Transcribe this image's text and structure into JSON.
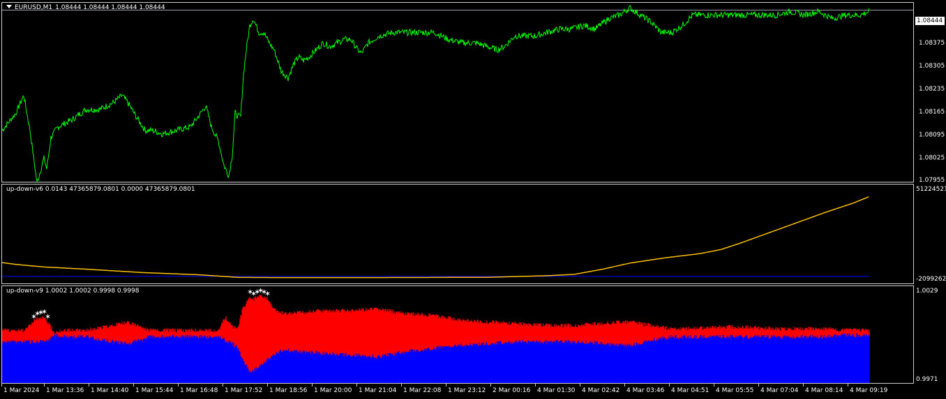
{
  "pane_main": {
    "symbol": "EURUSD,M1",
    "ohlc": "1.08444 1.08444 1.08444 1.08444",
    "current_price": "1.08444",
    "price_ticks": [
      "1.08375",
      "1.08305",
      "1.08235",
      "1.08165",
      "1.08095",
      "1.08025",
      "1.07955"
    ],
    "line_color": "#00ff00"
  },
  "pane_ind1": {
    "label": "up-down-v6 0.0143 47365879.0801 0.0000 47365879.0801",
    "top_tick": "51224521.",
    "bottom_tick": "-2099262.",
    "line_color": "#ffc000",
    "base_color": "#0000ff"
  },
  "pane_ind2": {
    "label": "up-down-v9 1.0002 1.0002 0.9998 0.9998",
    "top_tick": "1.0029",
    "bottom_tick": "0.9971",
    "up_color": "#ff0000",
    "down_color": "#0000ff",
    "marker_color": "#ffffff"
  },
  "time_axis": [
    "1 Mar 2024",
    "1 Mar 13:36",
    "1 Mar 14:40",
    "1 Mar 15:44",
    "1 Mar 16:48",
    "1 Mar 17:52",
    "1 Mar 18:56",
    "1 Mar 20:00",
    "1 Mar 21:04",
    "1 Mar 22:08",
    "1 Mar 23:12",
    "2 Mar 00:16",
    "4 Mar 01:30",
    "4 Mar 02:42",
    "4 Mar 03:46",
    "4 Mar 04:51",
    "4 Mar 05:55",
    "4 Mar 07:04",
    "4 Mar 08:14",
    "4 Mar 09:19"
  ],
  "chart_data": [
    {
      "type": "line",
      "ylim": [
        1.07955,
        1.08445
      ],
      "x": [
        0,
        20,
        31,
        40,
        50,
        60,
        64,
        70,
        80,
        100,
        120,
        140,
        160,
        172,
        180,
        195,
        205,
        215,
        230,
        250,
        270,
        285,
        292,
        300,
        310,
        318,
        325,
        330,
        334,
        338,
        342,
        346,
        350,
        355,
        360,
        368,
        375,
        383,
        390,
        400,
        410,
        418,
        425,
        432,
        440,
        450,
        460,
        470,
        480,
        490,
        500,
        510,
        515,
        525,
        540,
        560,
        575,
        590,
        605,
        620,
        630,
        640,
        660,
        680,
        695,
        710,
        720,
        735,
        750,
        765,
        780,
        800,
        815,
        835,
        850,
        870,
        885,
        900,
        915,
        930,
        945,
        960,
        975,
        990,
        1010,
        1030,
        1050,
        1070,
        1090,
        1110,
        1130,
        1150,
        1170,
        1190,
        1210,
        1230,
        1243
      ],
      "y": [
        1.081,
        1.0815,
        1.082,
        1.081,
        1.0795,
        1.0802,
        1.0799,
        1.0808,
        1.0811,
        1.0813,
        1.0816,
        1.0816,
        1.0818,
        1.082,
        1.0818,
        1.0813,
        1.081,
        1.081,
        1.0809,
        1.081,
        1.0811,
        1.0815,
        1.0817,
        1.0811,
        1.0807,
        1.08,
        1.0797,
        1.0803,
        1.0815,
        1.0814,
        1.0814,
        1.0826,
        1.0833,
        1.084,
        1.0842,
        1.0838,
        1.0838,
        1.0835,
        1.0833,
        1.0827,
        1.0825,
        1.0829,
        1.0831,
        1.083,
        1.0831,
        1.0833,
        1.0835,
        1.0834,
        1.0835,
        1.0836,
        1.0836,
        1.0833,
        1.0832,
        1.0835,
        1.0837,
        1.0838,
        1.0838,
        1.0838,
        1.0838,
        1.0838,
        1.0837,
        1.0836,
        1.0835,
        1.0835,
        1.0834,
        1.0833,
        1.0834,
        1.0837,
        1.0837,
        1.0837,
        1.0838,
        1.0839,
        1.0839,
        1.084,
        1.0839,
        1.0842,
        1.0843,
        1.0845,
        1.0843,
        1.0841,
        1.0838,
        1.0838,
        1.084,
        1.0843,
        1.0843,
        1.0843,
        1.0843,
        1.0843,
        1.0843,
        1.0843,
        1.0844,
        1.0843,
        1.0844,
        1.0842,
        1.0843,
        1.0843,
        1.0844
      ]
    },
    {
      "type": "line",
      "ylim": [
        -2099262,
        51224521
      ],
      "x": [
        0,
        20,
        60,
        120,
        200,
        280,
        340,
        400,
        500,
        600,
        700,
        780,
        820,
        860,
        900,
        950,
        1000,
        1030,
        1060,
        1100,
        1140,
        1180,
        1220,
        1243
      ],
      "y": [
        8200000,
        7100000,
        5600000,
        4300000,
        2300000,
        1000000,
        -600000,
        -700000,
        -700000,
        -650000,
        -500000,
        400000,
        1200000,
        4200000,
        7900000,
        11000000,
        13500000,
        15900000,
        20000000,
        26000000,
        32000000,
        38000000,
        43500000,
        47365879
      ]
    },
    {
      "type": "area",
      "ylim": [
        0.9971,
        1.0029
      ],
      "x": [
        0,
        30,
        40,
        50,
        60,
        65,
        75,
        90,
        100,
        120,
        160,
        180,
        200,
        210,
        240,
        280,
        295,
        310,
        320,
        330,
        338,
        345,
        355,
        360,
        370,
        380,
        395,
        410,
        430,
        460,
        500,
        540,
        580,
        620,
        660,
        700,
        740,
        780,
        820,
        860,
        880,
        900,
        915,
        930,
        960,
        990,
        1030,
        1070,
        1110,
        1150,
        1180,
        1210,
        1243
      ],
      "upper": [
        1.0003,
        1.0003,
        1.0006,
        1.001,
        1.0011,
        1.0008,
        1.0002,
        1.0003,
        1.0003,
        1.0003,
        1.0006,
        1.0008,
        1.0005,
        1.0003,
        1.0003,
        1.0003,
        1.0003,
        1.0003,
        1.0011,
        1.0005,
        1.0005,
        1.0016,
        1.0023,
        1.0022,
        1.0024,
        1.0022,
        1.0014,
        1.0013,
        1.0014,
        1.0015,
        1.0015,
        1.0016,
        1.0013,
        1.0012,
        1.0009,
        1.0008,
        1.0007,
        1.0006,
        1.0006,
        1.0007,
        1.0008,
        1.0008,
        1.0007,
        1.0006,
        1.0004,
        1.0004,
        1.0005,
        1.0005,
        1.0004,
        1.0004,
        1.0004,
        1.0003,
        1.0003
      ],
      "lower": [
        0.9996,
        0.9996,
        0.9996,
        0.9996,
        0.9996,
        0.9996,
        1.0,
        0.9999,
        0.9999,
        0.9999,
        0.9996,
        0.9995,
        0.9997,
        0.9999,
        0.9999,
        0.9999,
        0.9999,
        0.9999,
        0.9997,
        0.9995,
        0.9992,
        0.9985,
        0.9978,
        0.9978,
        0.9982,
        0.9985,
        0.999,
        0.9991,
        0.999,
        0.9989,
        0.9988,
        0.9987,
        0.999,
        0.9992,
        0.9994,
        0.9995,
        0.9996,
        0.9996,
        0.9996,
        0.9995,
        0.9994,
        0.9994,
        0.9995,
        0.9997,
        0.9999,
        0.9999,
        0.9999,
        0.9999,
        0.9999,
        0.9999,
        0.9999,
        1.0,
        1.0
      ],
      "markers_x": [
        45,
        50,
        55,
        60,
        65,
        355,
        360,
        365,
        370,
        375,
        380
      ]
    }
  ]
}
